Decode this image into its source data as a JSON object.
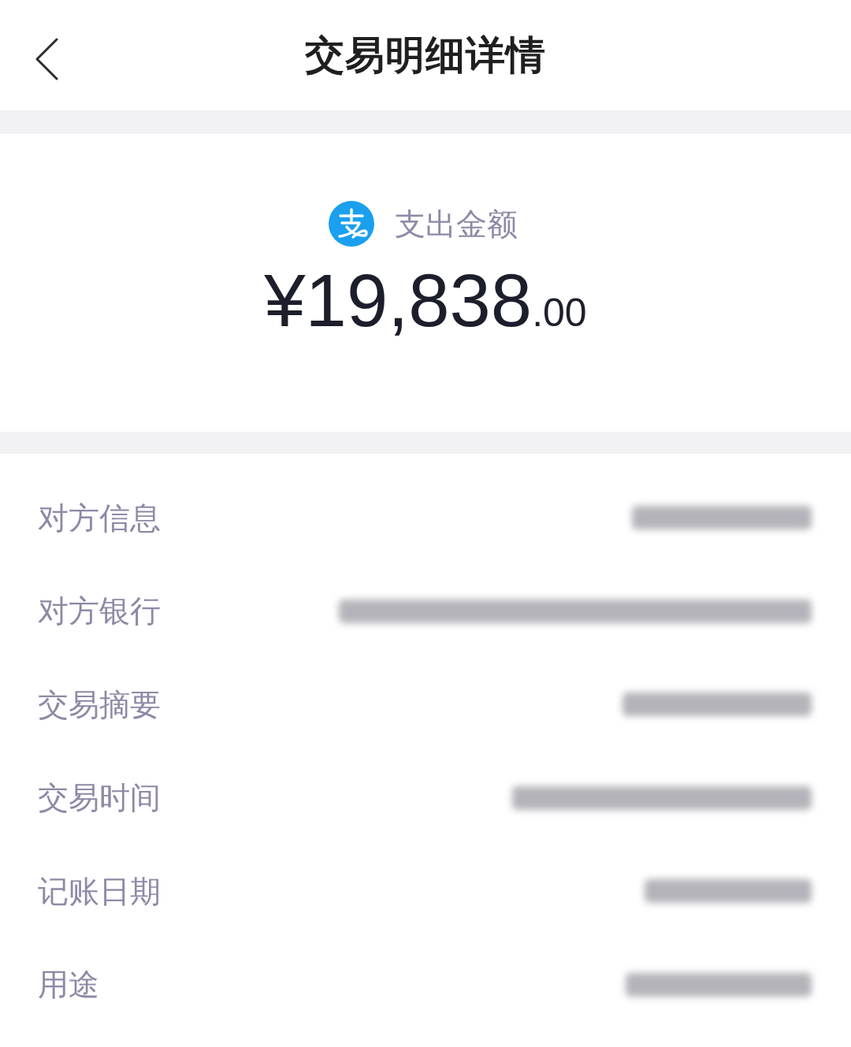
{
  "header": {
    "title": "交易明细详情"
  },
  "summary": {
    "label": "支出金额",
    "amount": {
      "main": "¥19,838",
      "cents": ".00"
    }
  },
  "details": [
    {
      "label": "对方信息",
      "redacted": true
    },
    {
      "label": "对方银行",
      "redacted": true
    },
    {
      "label": "交易摘要",
      "redacted": true
    },
    {
      "label": "交易时间",
      "redacted": true
    },
    {
      "label": "记账日期",
      "redacted": true
    },
    {
      "label": "用途",
      "redacted": true
    }
  ]
}
